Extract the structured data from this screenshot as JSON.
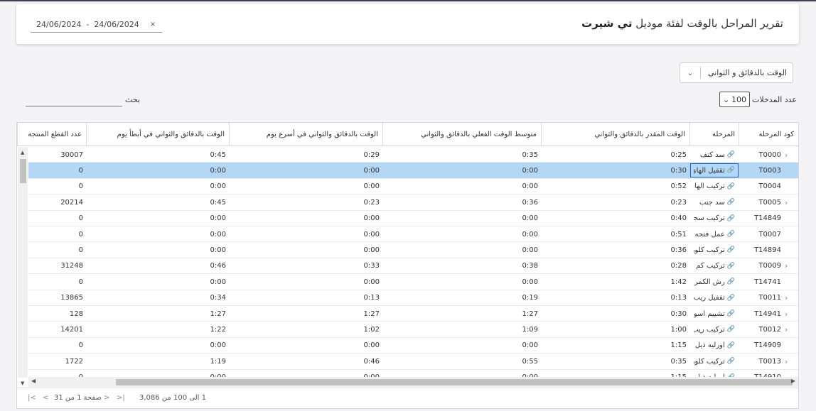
{
  "header": {
    "title_prefix": "تقرير المراحل بالوقت لفئة موديل",
    "title_model": "تي شيرت",
    "date_from": "24/06/2024",
    "date_to": "24/06/2024",
    "date_sep": "-",
    "clear_icon": "×"
  },
  "filters": {
    "time_unit_label": "الوقت بالدقائق و الثواني",
    "entries_label": "عدد المدخلات",
    "entries_value": "100",
    "search_label": "بحث"
  },
  "columns": [
    "كود المرحلة",
    "المرحلة",
    "الوقت المقدر بالدقائق والثواني",
    "متوسط الوقت الفعلي بالدقائق والثواني",
    "الوقت بالدقائق والثواني في أسرع يوم",
    "الوقت بالدقائق والثواني في أبطأ يوم",
    "عدد القطع المنتجة"
  ],
  "rows": [
    {
      "code": "T0000",
      "expand": true,
      "stage": "سد كتف",
      "est": "0:25",
      "avg": "0:35",
      "fast": "0:29",
      "slow": "0:45",
      "qty": "30007"
    },
    {
      "code": "T0003",
      "expand": false,
      "stage": "تقفيل الهاي كول",
      "est": "0:30",
      "avg": "0:00",
      "fast": "0:00",
      "slow": "0:00",
      "qty": "0",
      "selected": true
    },
    {
      "code": "T0004",
      "expand": false,
      "stage": "تركيب الهاي كول",
      "est": "0:52",
      "avg": "0:00",
      "fast": "0:00",
      "slow": "0:00",
      "qty": "0"
    },
    {
      "code": "T0005",
      "expand": true,
      "stage": "سد جنب",
      "est": "0:23",
      "avg": "0:36",
      "fast": "0:23",
      "slow": "0:45",
      "qty": "20214"
    },
    {
      "code": "T14849",
      "expand": false,
      "stage": "تركيب سجافة",
      "est": "0:40",
      "avg": "0:00",
      "fast": "0:00",
      "slow": "0:00",
      "qty": "0"
    },
    {
      "code": "T0007",
      "expand": false,
      "stage": "عمل فتحه الحلق",
      "est": "0:51",
      "avg": "0:00",
      "fast": "0:00",
      "slow": "0:00",
      "qty": "0"
    },
    {
      "code": "T14894",
      "expand": false,
      "stage": "تركيب كلوريت",
      "est": "0:36",
      "avg": "0:00",
      "fast": "0:00",
      "slow": "0:00",
      "qty": "0"
    },
    {
      "code": "T0009",
      "expand": true,
      "stage": "تركيب كم",
      "est": "0:28",
      "avg": "0:38",
      "fast": "0:33",
      "slow": "0:46",
      "qty": "31248"
    },
    {
      "code": "T14741",
      "expand": false,
      "stage": "رش الكمر",
      "est": "1:42",
      "avg": "0:00",
      "fast": "0:00",
      "slow": "0:00",
      "qty": "0"
    },
    {
      "code": "T0011",
      "expand": true,
      "stage": "تقفيل ريب الرقبة",
      "est": "0:13",
      "avg": "0:19",
      "fast": "0:13",
      "slow": "0:34",
      "qty": "13865"
    },
    {
      "code": "T14941",
      "expand": true,
      "stage": "تشييم اسوره",
      "est": "0:30",
      "avg": "1:27",
      "fast": "1:27",
      "slow": "1:27",
      "qty": "128"
    },
    {
      "code": "T0012",
      "expand": true,
      "stage": "تركيب ريب الرقبة",
      "est": "1:00",
      "avg": "1:09",
      "fast": "1:02",
      "slow": "1:22",
      "qty": "14201"
    },
    {
      "code": "T14909",
      "expand": false,
      "stage": "اورليه ذيل وجنب",
      "est": "1:15",
      "avg": "0:00",
      "fast": "0:00",
      "slow": "0:00",
      "qty": "0"
    },
    {
      "code": "T0013",
      "expand": true,
      "stage": "تركيب كلوريت",
      "est": "0:35",
      "avg": "0:55",
      "fast": "0:46",
      "slow": "1:19",
      "qty": "1722"
    },
    {
      "code": "T14910",
      "expand": false,
      "stage": "اورليه ذيل وجنب",
      "est": "1:15",
      "avg": "0:00",
      "fast": "0:00",
      "slow": "0:00",
      "qty": "0"
    }
  ],
  "pager": {
    "page_text": "صفحة 1 من 31",
    "summary": "1 الى 100 من 3,086",
    "first": "|<",
    "prev": "<",
    "next": ">",
    "last": ">|"
  },
  "icons": {
    "link": "🔗",
    "expand": "›",
    "chevron": "⌄"
  }
}
